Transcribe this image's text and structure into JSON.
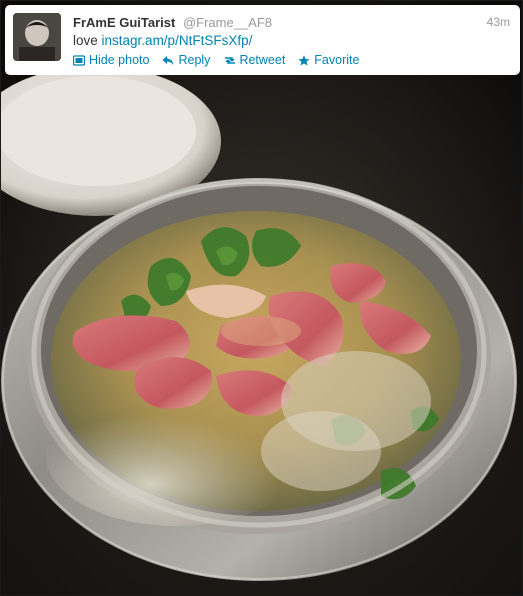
{
  "tweet": {
    "fullname": "FrAmE GuiTarist",
    "screen_name": "@Frame__AF8",
    "time": "43m",
    "text_prefix": "love ",
    "link_text": "instagr.am/p/NtFtSFsXfp/",
    "actions": {
      "hide_photo": "Hide photo",
      "reply": "Reply",
      "retweet": "Retweet",
      "favorite": "Favorite"
    }
  },
  "photo": {
    "subject": "pot of soup with sliced duck meat and greens"
  },
  "colors": {
    "link": "#0084b4",
    "name": "#333333",
    "muted": "#999999"
  }
}
